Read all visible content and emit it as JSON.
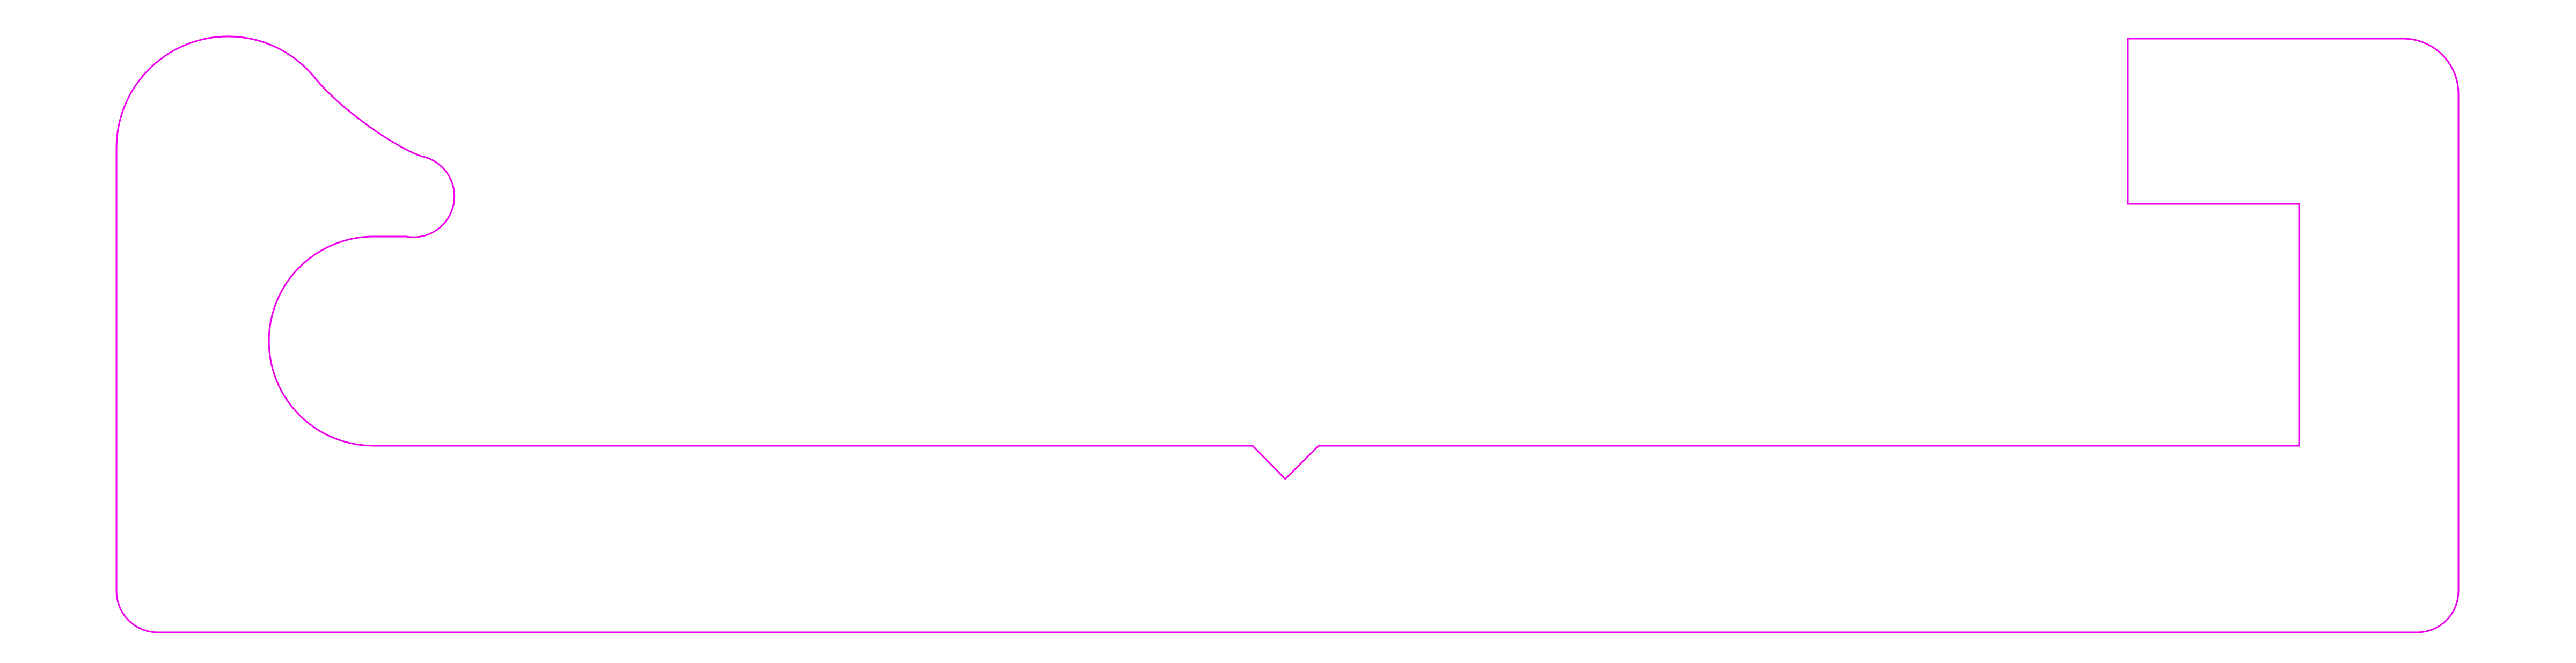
{
  "diagram": {
    "type": "cut-outline",
    "stroke_color": "#ee00ee",
    "background_color": "#ffffff",
    "texts": []
  }
}
